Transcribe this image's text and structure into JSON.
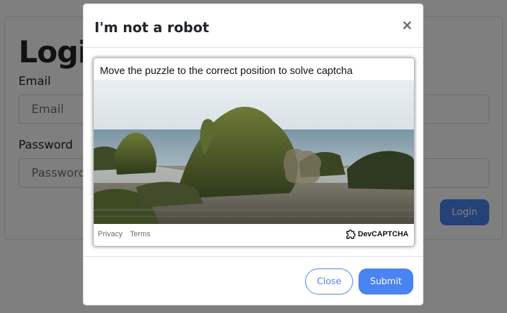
{
  "login": {
    "title": "Login",
    "email_label": "Email",
    "email_placeholder": "Email",
    "password_label": "Password",
    "password_placeholder": "Password",
    "login_button": "Login"
  },
  "modal": {
    "title": "I'm not a robot",
    "close_glyph": "×",
    "captcha": {
      "instruction": "Move the puzzle to the correct position to solve captcha",
      "privacy_link": "Privacy",
      "terms_link": "Terms",
      "brand": "DevCAPTCHA",
      "image_icon": "puzzle-piece-icon"
    },
    "close_button": "Close",
    "submit_button": "Submit"
  },
  "colors": {
    "accent": "#4a84f0",
    "backdrop": "rgba(0,0,0,0.5)"
  }
}
